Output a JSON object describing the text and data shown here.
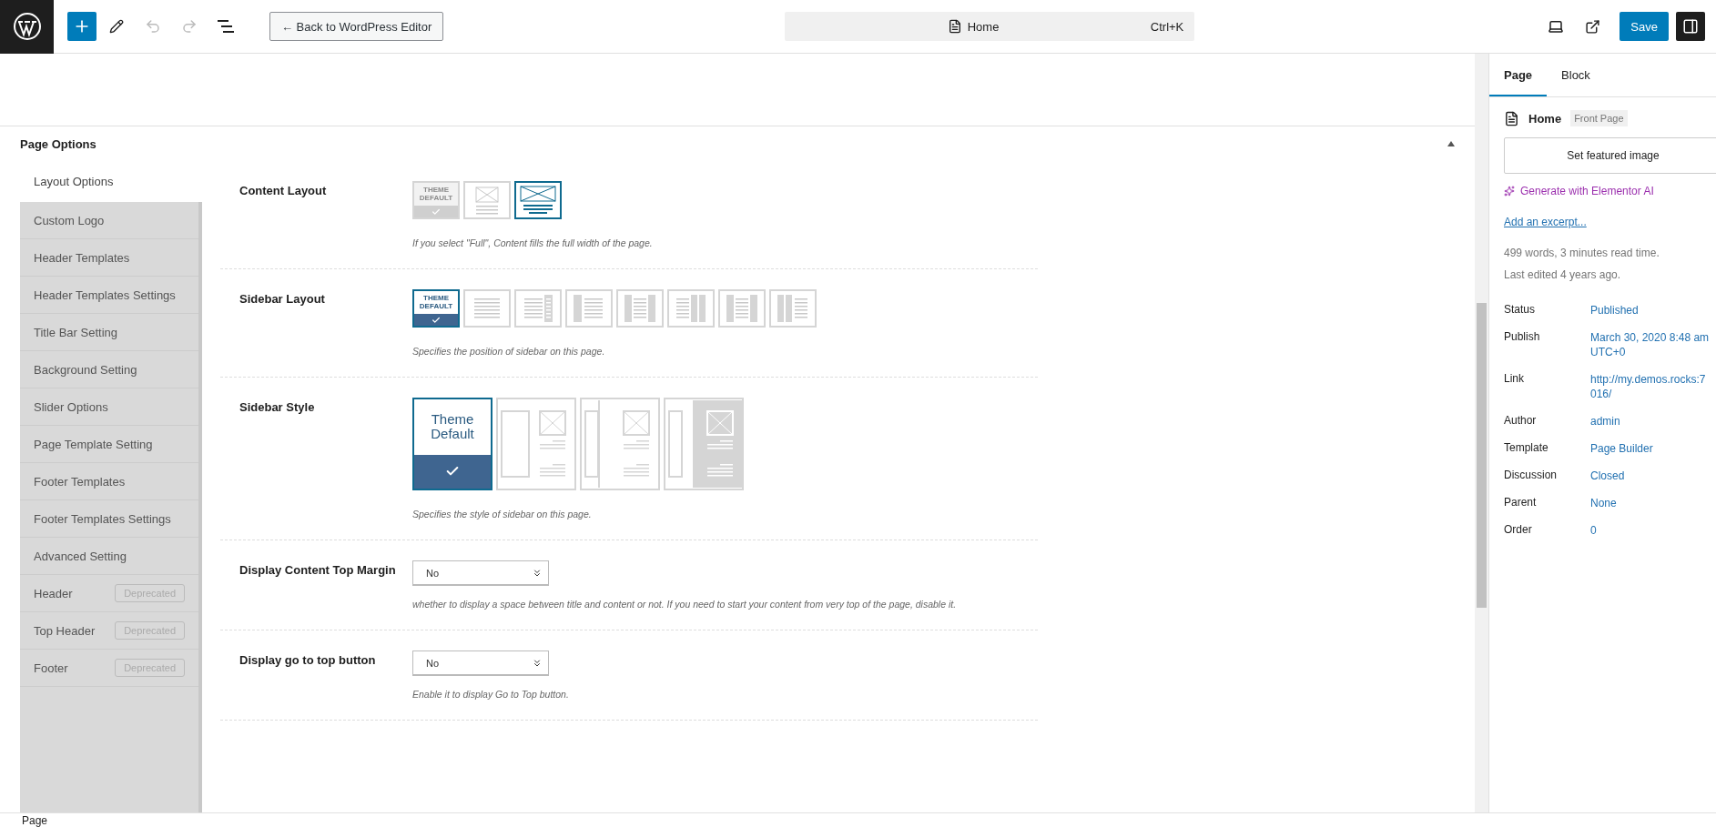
{
  "topbar": {
    "back_button": "← Back to WordPress Editor",
    "document_title": "Home",
    "shortcut": "Ctrl+K",
    "save_button": "Save",
    "undo_disabled": true,
    "redo_disabled": true
  },
  "page_options": {
    "title": "Page Options",
    "tab": "Layout Options",
    "nav_items": [
      {
        "label": "Custom Logo",
        "selected": false
      },
      {
        "label": "Header Templates",
        "selected": false
      },
      {
        "label": "Header Templates Settings",
        "selected": false
      },
      {
        "label": "Title Bar Setting",
        "selected": false
      },
      {
        "label": "Background Setting",
        "selected": false
      },
      {
        "label": "Slider Options",
        "selected": false
      },
      {
        "label": "Page Template Setting",
        "selected": false
      },
      {
        "label": "Footer Templates",
        "selected": false
      },
      {
        "label": "Footer Templates Settings",
        "selected": false
      },
      {
        "label": "Advanced Setting",
        "selected": false
      },
      {
        "label": "Header",
        "selected": false,
        "badge": "Deprecated"
      },
      {
        "label": "Top Header",
        "selected": false,
        "badge": "Deprecated"
      },
      {
        "label": "Footer",
        "selected": false,
        "badge": "Deprecated"
      }
    ],
    "sections": [
      {
        "kind": "tiles",
        "label": "Content Layout",
        "help": "If you select \"Full\", Content fills the full width of the page.",
        "options": [
          {
            "kind": "default",
            "label": "THEME DEFAULT",
            "selected": false
          },
          {
            "kind": "boxed",
            "selected": false
          },
          {
            "kind": "full",
            "selected": true
          }
        ]
      },
      {
        "kind": "tiles",
        "label": "Sidebar Layout",
        "help": "Specifies the position of sidebar on this page.",
        "options": [
          {
            "kind": "default",
            "label": "THEME DEFAULT",
            "selected": true
          },
          {
            "kind": "none",
            "selected": false
          },
          {
            "kind": "right",
            "selected": false
          },
          {
            "kind": "left",
            "selected": false
          },
          {
            "kind": "both",
            "selected": false
          },
          {
            "kind": "right-two",
            "selected": false
          },
          {
            "kind": "left-right",
            "selected": false
          },
          {
            "kind": "left-two",
            "selected": false
          }
        ]
      },
      {
        "kind": "styles",
        "label": "Sidebar Style",
        "help": "Specifies the style of sidebar on this page.",
        "options": [
          {
            "kind": "default",
            "label": "Theme Default",
            "selected": true
          },
          {
            "kind": "separated",
            "selected": false
          },
          {
            "kind": "joined",
            "selected": false
          },
          {
            "kind": "filled",
            "selected": false
          }
        ]
      },
      {
        "kind": "select",
        "label": "Display Content Top Margin",
        "value": "No",
        "help": "whether to display a space between title and content or not. If you need to start your content from very top of the page, disable it."
      },
      {
        "kind": "select",
        "label": "Display go to top button",
        "value": "No",
        "help": "Enable it to display Go to Top button."
      }
    ]
  },
  "sidebar": {
    "tabs": [
      {
        "label": "Page",
        "selected": true
      },
      {
        "label": "Block",
        "selected": false
      }
    ],
    "post_title": "Home",
    "post_badge": "Front Page",
    "featured_button": "Set featured image",
    "ai_link": "Generate with Elementor AI",
    "excerpt_link": "Add an excerpt...",
    "stats": [
      "499 words, 3 minutes read time.",
      "Last edited 4 years ago."
    ],
    "rows": [
      {
        "label": "Status",
        "value": [
          "Published"
        ]
      },
      {
        "label": "Publish",
        "value": [
          "March 30, 2020 8:48 am",
          "UTC+0"
        ]
      },
      {
        "label": "Link",
        "value": [
          "http://my.demos.rocks:7",
          "016/"
        ]
      },
      {
        "label": "Author",
        "value": [
          "admin"
        ]
      },
      {
        "label": "Template",
        "value": [
          "Page Builder"
        ]
      },
      {
        "label": "Discussion",
        "value": [
          "Closed"
        ]
      },
      {
        "label": "Parent",
        "value": [
          "None"
        ]
      },
      {
        "label": "Order",
        "value": [
          "0"
        ]
      }
    ]
  },
  "footer": {
    "breadcrumb": "Page"
  }
}
